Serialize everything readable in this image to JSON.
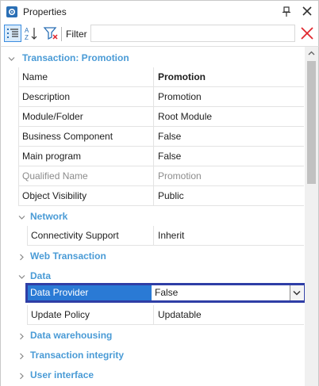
{
  "window": {
    "title": "Properties"
  },
  "toolbar": {
    "filter_label": "Filter",
    "filter_value": ""
  },
  "grid": {
    "transaction_header": "Transaction: Promotion",
    "properties": [
      {
        "name": "Name",
        "value": "Promotion"
      },
      {
        "name": "Description",
        "value": "Promotion"
      },
      {
        "name": "Module/Folder",
        "value": "Root Module"
      },
      {
        "name": "Business Component",
        "value": "False"
      },
      {
        "name": "Main program",
        "value": "False"
      },
      {
        "name": "Qualified Name",
        "value": "Promotion"
      },
      {
        "name": "Object Visibility",
        "value": "Public"
      }
    ],
    "categories": {
      "network": "Network",
      "web_transaction": "Web Transaction",
      "data": "Data",
      "data_warehousing": "Data warehousing",
      "transaction_integrity": "Transaction integrity",
      "user_interface": "User interface"
    },
    "network_props": [
      {
        "name": "Connectivity Support",
        "value": "Inherit"
      }
    ],
    "data_props": [
      {
        "name": "Data Provider",
        "value": "False"
      },
      {
        "name": "Update Policy",
        "value": "Updatable"
      }
    ]
  },
  "colors": {
    "category": "#4a9bd6",
    "selection": "#2a7ad5",
    "focus_border": "#2f3ea6",
    "clear_icon": "#e0272e"
  },
  "icons": {
    "title": "settings-gear-icon",
    "pin": "pin-icon",
    "close": "close-icon",
    "categorized": "categorized-view-icon",
    "sort": "sort-az-icon",
    "filter": "filter-funnel-icon",
    "clear": "clear-filter-icon"
  }
}
